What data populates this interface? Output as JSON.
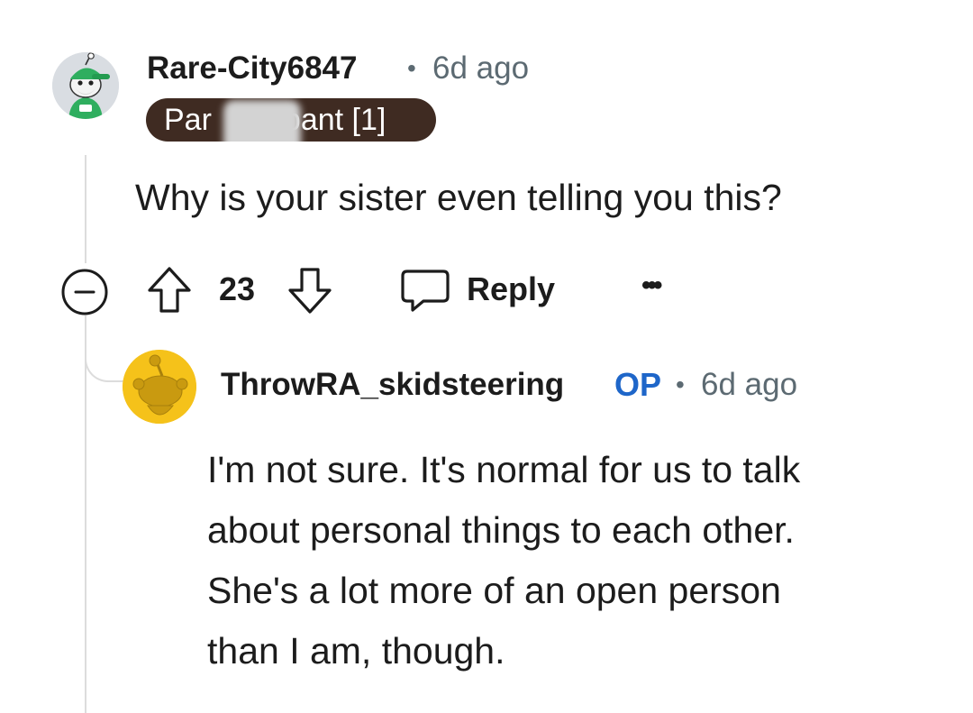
{
  "comment": {
    "author": "Rare-City6847",
    "separator": "•",
    "time": "6d ago",
    "flair": {
      "visible_start": "Par",
      "visible_end": "pant [1]"
    },
    "body": "Why is your sister even telling you this?",
    "actions": {
      "collapse_icon": "minus-circle-icon",
      "upvote_icon": "arrow-up-icon",
      "score": "23",
      "downvote_icon": "arrow-down-icon",
      "reply_icon": "speech-bubble-icon",
      "reply_label": "Reply",
      "more_label": "•••"
    }
  },
  "reply": {
    "author": "ThrowRA_skidsteering",
    "op_badge": "OP",
    "separator": "•",
    "time": "6d ago",
    "body_lines": [
      "I'm not sure. It's normal for us to talk",
      "about personal things to each other.",
      "She's a lot more of an open person",
      "than I am, though."
    ]
  },
  "colors": {
    "flair_bg": "#3f2b22",
    "op_blue": "#1e66c9",
    "meta_gray": "#5c6a72",
    "avatar2_bg": "#f5c21a",
    "thread_line": "#dcdcdc"
  }
}
